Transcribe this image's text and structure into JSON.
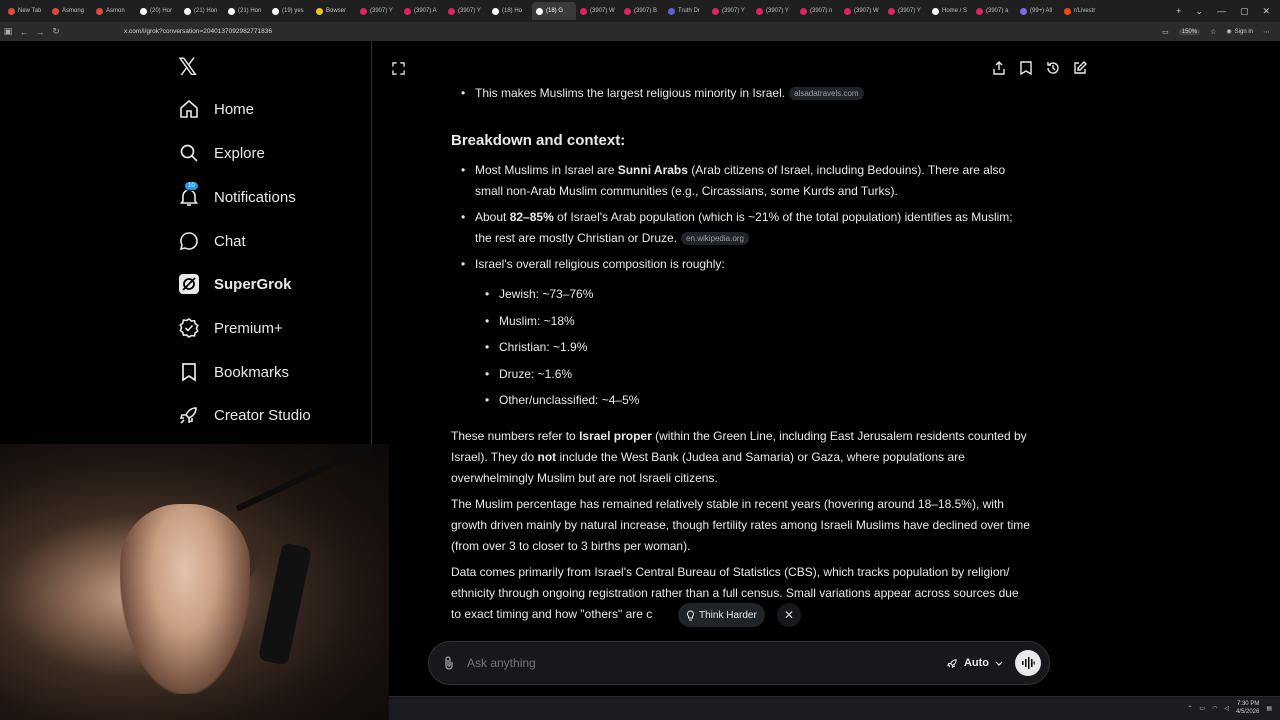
{
  "browser": {
    "tabs": [
      {
        "label": "New Tab",
        "color": "#e04a3a"
      },
      {
        "label": "Asmong",
        "color": "#e04a3a"
      },
      {
        "label": "Asmon",
        "color": "#e04a3a"
      },
      {
        "label": "(20) Hor",
        "color": "#ffffff"
      },
      {
        "label": "(21) Hon",
        "color": "#ffffff"
      },
      {
        "label": "(21) Hon",
        "color": "#ffffff"
      },
      {
        "label": "(19) yes",
        "color": "#ffffff"
      },
      {
        "label": "Bowser",
        "color": "#f0c419"
      },
      {
        "label": "(3907) Y",
        "color": "#e0245e"
      },
      {
        "label": "(3907) A",
        "color": "#e0245e"
      },
      {
        "label": "(3907) Y",
        "color": "#e0245e"
      },
      {
        "label": "(18) Ho",
        "color": "#ffffff"
      },
      {
        "label": "(18) G",
        "color": "#ffffff",
        "active": true
      },
      {
        "label": "(3907) W",
        "color": "#e0245e"
      },
      {
        "label": "(3907) B",
        "color": "#e0245e"
      },
      {
        "label": "Truth Dr",
        "color": "#5a5fd6"
      },
      {
        "label": "(3907) Y",
        "color": "#e0245e"
      },
      {
        "label": "(3907) Y",
        "color": "#e0245e"
      },
      {
        "label": "(3907) n",
        "color": "#e0245e"
      },
      {
        "label": "(3907) W",
        "color": "#e0245e"
      },
      {
        "label": "(3907) Y",
        "color": "#e0245e"
      },
      {
        "label": "Home / S",
        "color": "#ffffff"
      },
      {
        "label": "(3907) a",
        "color": "#e0245e"
      },
      {
        "label": "(99+) All",
        "color": "#7b68ee"
      },
      {
        "label": "r/Livestr",
        "color": "#ff4500"
      }
    ],
    "url": "x.com/i/grok?conversation=2040137092982771836",
    "zoom": "150%",
    "sign_in": "Sign in"
  },
  "sidebar": {
    "items": [
      {
        "label": "Home",
        "icon": "home-icon"
      },
      {
        "label": "Explore",
        "icon": "search-icon"
      },
      {
        "label": "Notifications",
        "icon": "bell-icon",
        "badge": "10"
      },
      {
        "label": "Chat",
        "icon": "chat-icon"
      },
      {
        "label": "SuperGrok",
        "icon": "grok-icon",
        "bold": true
      },
      {
        "label": "Premium+",
        "icon": "verified-icon"
      },
      {
        "label": "Bookmarks",
        "icon": "bookmark-icon"
      },
      {
        "label": "Creator Studio",
        "icon": "rocket-icon"
      }
    ]
  },
  "content": {
    "line_top": "This makes Muslims the largest religious minority in Israel.",
    "src_top": "alsadatravels.com",
    "heading": "Breakdown and context:",
    "b1": {
      "pre": "Most Muslims in Israel are ",
      "bold": "Sunni Arabs",
      "post": " (Arab citizens of Israel, including Bedouins). There are also small non-Arab Muslim communities (e.g., Circassians, some Kurds and Turks)."
    },
    "b2": {
      "pre": "About ",
      "bold": "82–85%",
      "post": " of Israel's Arab population (which is ~21% of the total population) identifies as Muslim; the rest are mostly Christian or Druze.",
      "src": "en.wikipedia.org"
    },
    "b3": "Israel's overall religious composition is roughly:",
    "composition": [
      "Jewish: ~73–76%",
      "Muslim: ~18%",
      "Christian: ~1.9%",
      "Druze: ~1.6%",
      "Other/unclassified: ~4–5%"
    ],
    "p1": {
      "pre": "These numbers refer to ",
      "bold": "Israel proper",
      "mid": " (within the Green Line, including East Jerusalem residents counted by Israel). They do ",
      "bold2": "not",
      "post": " include the West Bank (Judea and Samaria) or Gaza, where populations are overwhelmingly Muslim but are not Israeli citizens."
    },
    "p2": "The Muslim percentage has remained relatively stable in recent years (hovering around 18–18.5%), with growth driven mainly by natural increase, though fertility rates among Israeli Muslims have declined over time (from over 3 to closer to 3 births per woman).",
    "p3": "Data comes primarily from Israel's Central Bureau of Statistics (CBS), which tracks population by religion/ ethnicity through ongoing registration rather than a full census. Small variations appear across sources due to exact timing and how \"others\" are c"
  },
  "think_harder": "Think Harder",
  "ask": {
    "placeholder": "Ask anything",
    "mode": "Auto"
  },
  "clock": {
    "time": "7:30 PM",
    "date": "4/5/2026"
  }
}
